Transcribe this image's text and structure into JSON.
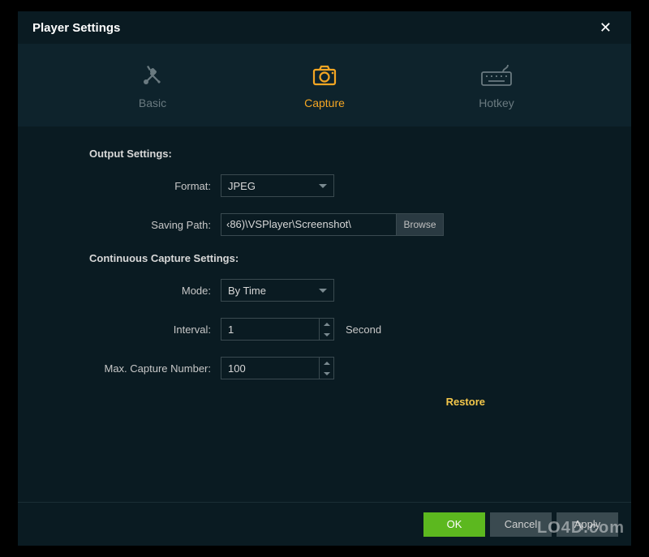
{
  "window": {
    "title": "Player Settings"
  },
  "tabs": {
    "basic": "Basic",
    "capture": "Capture",
    "hotkey": "Hotkey"
  },
  "output": {
    "heading": "Output Settings:",
    "format_label": "Format:",
    "format_value": "JPEG",
    "path_label": "Saving Path:",
    "path_value": "‹86)\\VSPlayer\\Screenshot\\",
    "browse": "Browse"
  },
  "continuous": {
    "heading": "Continuous Capture Settings:",
    "mode_label": "Mode:",
    "mode_value": "By Time",
    "interval_label": "Interval:",
    "interval_value": "1",
    "interval_unit": "Second",
    "max_label": "Max. Capture Number:",
    "max_value": "100"
  },
  "restore": "Restore",
  "footer": {
    "ok": "OK",
    "cancel": "Cancel",
    "apply": "Apply"
  },
  "watermark": "LO4D.com"
}
